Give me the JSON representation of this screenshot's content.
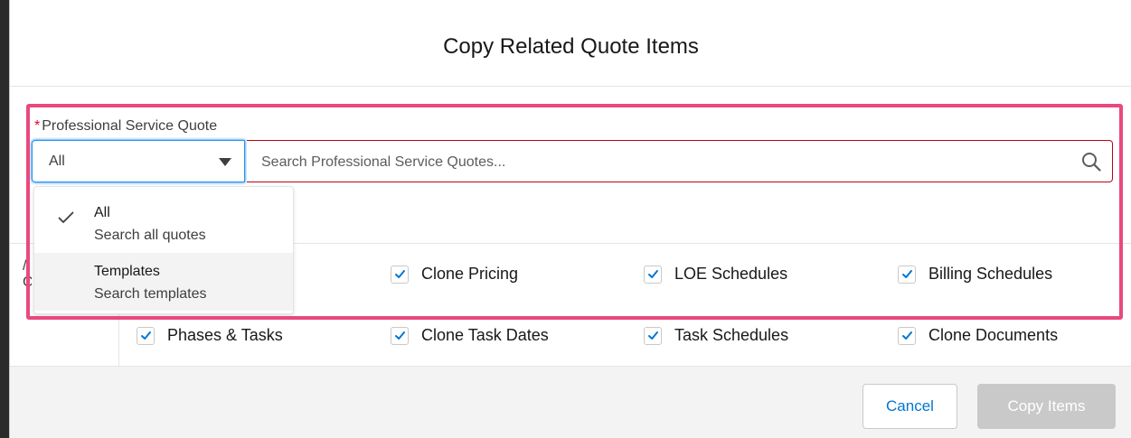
{
  "modal": {
    "title": "Copy Related Quote Items"
  },
  "field": {
    "required_marker": "*",
    "label": "Professional Service Quote"
  },
  "scope_select": {
    "value": "All"
  },
  "search": {
    "placeholder": "Search Professional Service Quotes...",
    "value": ""
  },
  "dropdown": {
    "items": [
      {
        "title": "All",
        "subtitle": "Search all quotes",
        "selected": true
      },
      {
        "title": "Templates",
        "subtitle": "Search templates",
        "selected": false
      }
    ]
  },
  "options": {
    "row1": [
      {
        "label": "Clone Pricing",
        "checked": true
      },
      {
        "label": "LOE Schedules",
        "checked": true
      },
      {
        "label": "Billing Schedules",
        "checked": true
      }
    ],
    "row2": [
      {
        "label": "Phases & Tasks",
        "checked": true
      },
      {
        "label": "Clone Task Dates",
        "checked": true
      },
      {
        "label": "Task Schedules",
        "checked": true
      },
      {
        "label": "Clone Documents",
        "checked": true
      }
    ]
  },
  "footer": {
    "cancel_label": "Cancel",
    "copy_label": "Copy Items"
  },
  "colors": {
    "brand": "#0176d3",
    "required": "#ea001e",
    "highlight": "#e8497e",
    "disabled_button": "#c9c9c9"
  }
}
